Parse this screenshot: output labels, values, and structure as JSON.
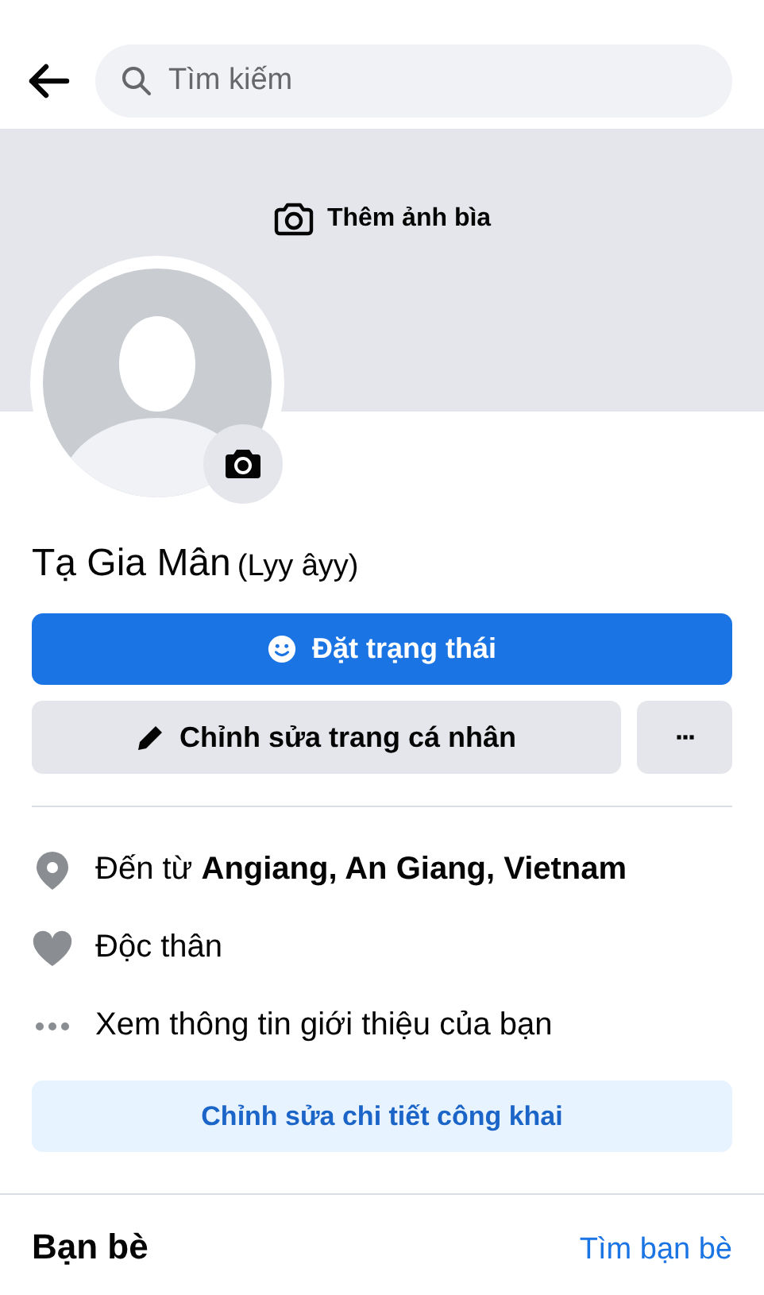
{
  "search": {
    "placeholder": "Tìm kiếm"
  },
  "cover": {
    "label": "Thêm ảnh bìa"
  },
  "profile": {
    "name": "Tạ Gia Mân",
    "nickname": "(Lyy âyy)"
  },
  "buttons": {
    "status": "Đặt trạng thái",
    "edit": "Chỉnh sửa trang cá nhân",
    "more": "···"
  },
  "info": [
    {
      "kind": "location",
      "text": "Đến từ **Angiang, An Giang, Vietnam**"
    },
    {
      "kind": "relationship",
      "text": "Độc thân"
    },
    {
      "kind": "more",
      "text": "Xem thông tin giới thiệu của bạn"
    }
  ],
  "edit_details": "Chỉnh sửa chi tiết công khai",
  "friends": {
    "title": "Bạn bè",
    "link": "Tìm bạn bè"
  }
}
